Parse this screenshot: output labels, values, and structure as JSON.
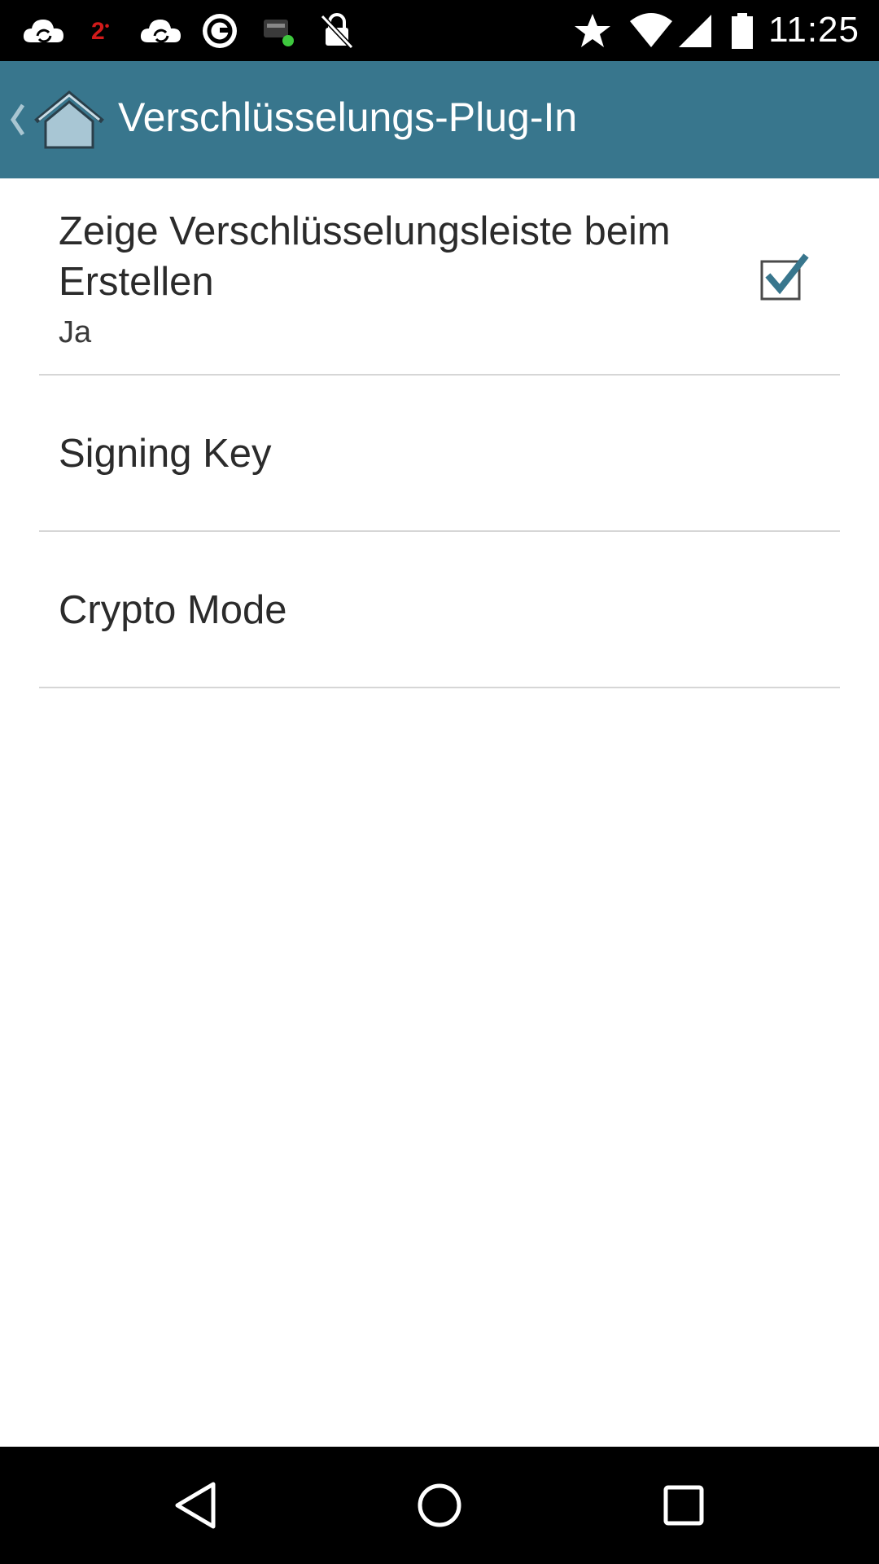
{
  "status_bar": {
    "time": "11:25",
    "notification_count": "2",
    "icons": [
      "cloud-sync-icon",
      "notification-count-badge",
      "cloud-sync-icon",
      "app-circle-icon",
      "sim-card-icon",
      "lock-off-icon",
      "star-icon",
      "wifi-icon",
      "cell-signal-icon",
      "battery-icon"
    ]
  },
  "action_bar": {
    "title": "Verschlüsselungs-Plug-In",
    "color": "#38768d"
  },
  "preferences": [
    {
      "title": "Zeige Verschlüsselungsleiste beim Erstellen",
      "summary": "Ja",
      "checked": true
    },
    {
      "title": "Signing Key"
    },
    {
      "title": "Crypto Mode"
    }
  ],
  "nav_bar": {
    "icons": [
      "back-icon",
      "home-icon",
      "recents-icon"
    ]
  },
  "colors": {
    "accent": "#38768d",
    "status_badge": "#d11a1a"
  }
}
